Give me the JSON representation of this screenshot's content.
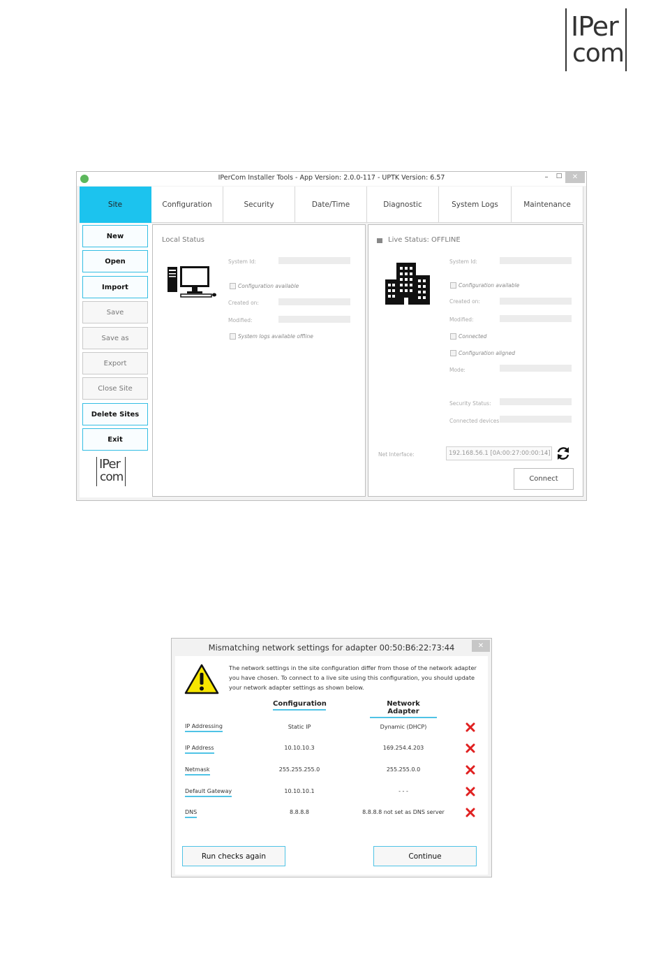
{
  "logo": {
    "line1": "IPer",
    "line2": "com"
  },
  "window": {
    "title": "IPerCom Installer Tools - App Version: 2.0.0-117 - UPTK Version: 6.57",
    "controls": {
      "minimize": "–",
      "maximize": "□",
      "close": "✕"
    },
    "tabs": [
      "Site",
      "Configuration",
      "Security",
      "Date/Time",
      "Diagnostic",
      "System Logs",
      "Maintenance"
    ],
    "active_tab": "Site",
    "sidebar": {
      "buttons": [
        {
          "label": "New",
          "enabled": true
        },
        {
          "label": "Open",
          "enabled": true
        },
        {
          "label": "Import",
          "enabled": true
        },
        {
          "label": "Save",
          "enabled": false
        },
        {
          "label": "Save as",
          "enabled": false
        },
        {
          "label": "Export",
          "enabled": false
        },
        {
          "label": "Close Site",
          "enabled": false
        },
        {
          "label": "Delete Sites",
          "enabled": true
        },
        {
          "label": "Exit",
          "enabled": true
        }
      ],
      "logo": {
        "line1": "IPer",
        "line2": "com"
      }
    },
    "local_status": {
      "title": "Local Status",
      "icon": "computer-icon",
      "system_id_label": "System Id:",
      "config_available_label": "Configuration available",
      "created_on_label": "Created on:",
      "modified_label": "Modified:",
      "logs_offline_label": "System logs available offline"
    },
    "live_status": {
      "title": "Live Status: OFFLINE",
      "icon": "building-icon",
      "system_id_label": "System Id:",
      "config_available_label": "Configuration available",
      "created_on_label": "Created on:",
      "modified_label": "Modified:",
      "connected_label": "Connected",
      "config_aligned_label": "Configuration aligned",
      "mode_label": "Mode:",
      "security_status_label": "Security Status:",
      "connected_devices_label": "Connected devices:",
      "net_interface_label": "Net Interface:",
      "net_interface_value": "192.168.56.1 [0A:00:27:00:00:14]",
      "connect_label": "Connect"
    }
  },
  "dialog": {
    "title": "Mismatching network settings for adapter 00:50:B6:22:73:44",
    "close": "✕",
    "message": "The network settings in the site configuration  differ from those of the network adapter you have chosen. To connect to a live site using this configuration, you should update your network adapter settings as shown below.",
    "col_config": "Configuration",
    "col_adapter": "Network Adapter",
    "rows": [
      {
        "label": "IP Addressing",
        "config": "Static IP",
        "adapter": "Dynamic (DHCP)"
      },
      {
        "label": "IP Address",
        "config": "10.10.10.3",
        "adapter": "169.254.4.203"
      },
      {
        "label": "Netmask",
        "config": "255.255.255.0",
        "adapter": "255.255.0.0"
      },
      {
        "label": "Default Gateway",
        "config": "10.10.10.1",
        "adapter": "- - -"
      },
      {
        "label": "DNS",
        "config": "8.8.8.8",
        "adapter": "8.8.8.8 not set as DNS server"
      }
    ],
    "mismatch_icon": "red-x-icon",
    "run_checks_label": "Run checks again",
    "continue_label": "Continue"
  },
  "colors": {
    "accent": "#1cc3ee",
    "link_underline": "#4fc3e6",
    "error": "#e02020"
  }
}
